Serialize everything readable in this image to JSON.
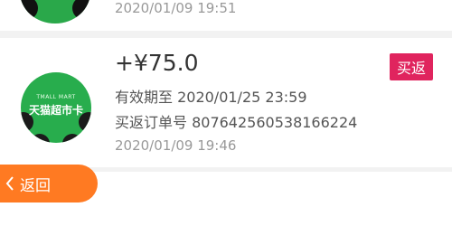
{
  "colors": {
    "accent_orange": "#ff7a22",
    "badge_red": "#e0245e",
    "logo_green": "#28ad4d",
    "divider": "#f2f2f2"
  },
  "previous_item": {
    "timestamp": "2020/01/09 19:51"
  },
  "item": {
    "logo_small_text": "TMALL MART",
    "logo_main_text": "天猫超市卡",
    "amount": "+¥75.0",
    "badge": "买返",
    "expiry": "有效期至 2020/01/25 23:59",
    "order": "买返订单号 807642560538166224",
    "timestamp": "2020/01/09 19:46"
  },
  "back_button": {
    "label": "返回",
    "icon": "chevron-left-icon"
  }
}
